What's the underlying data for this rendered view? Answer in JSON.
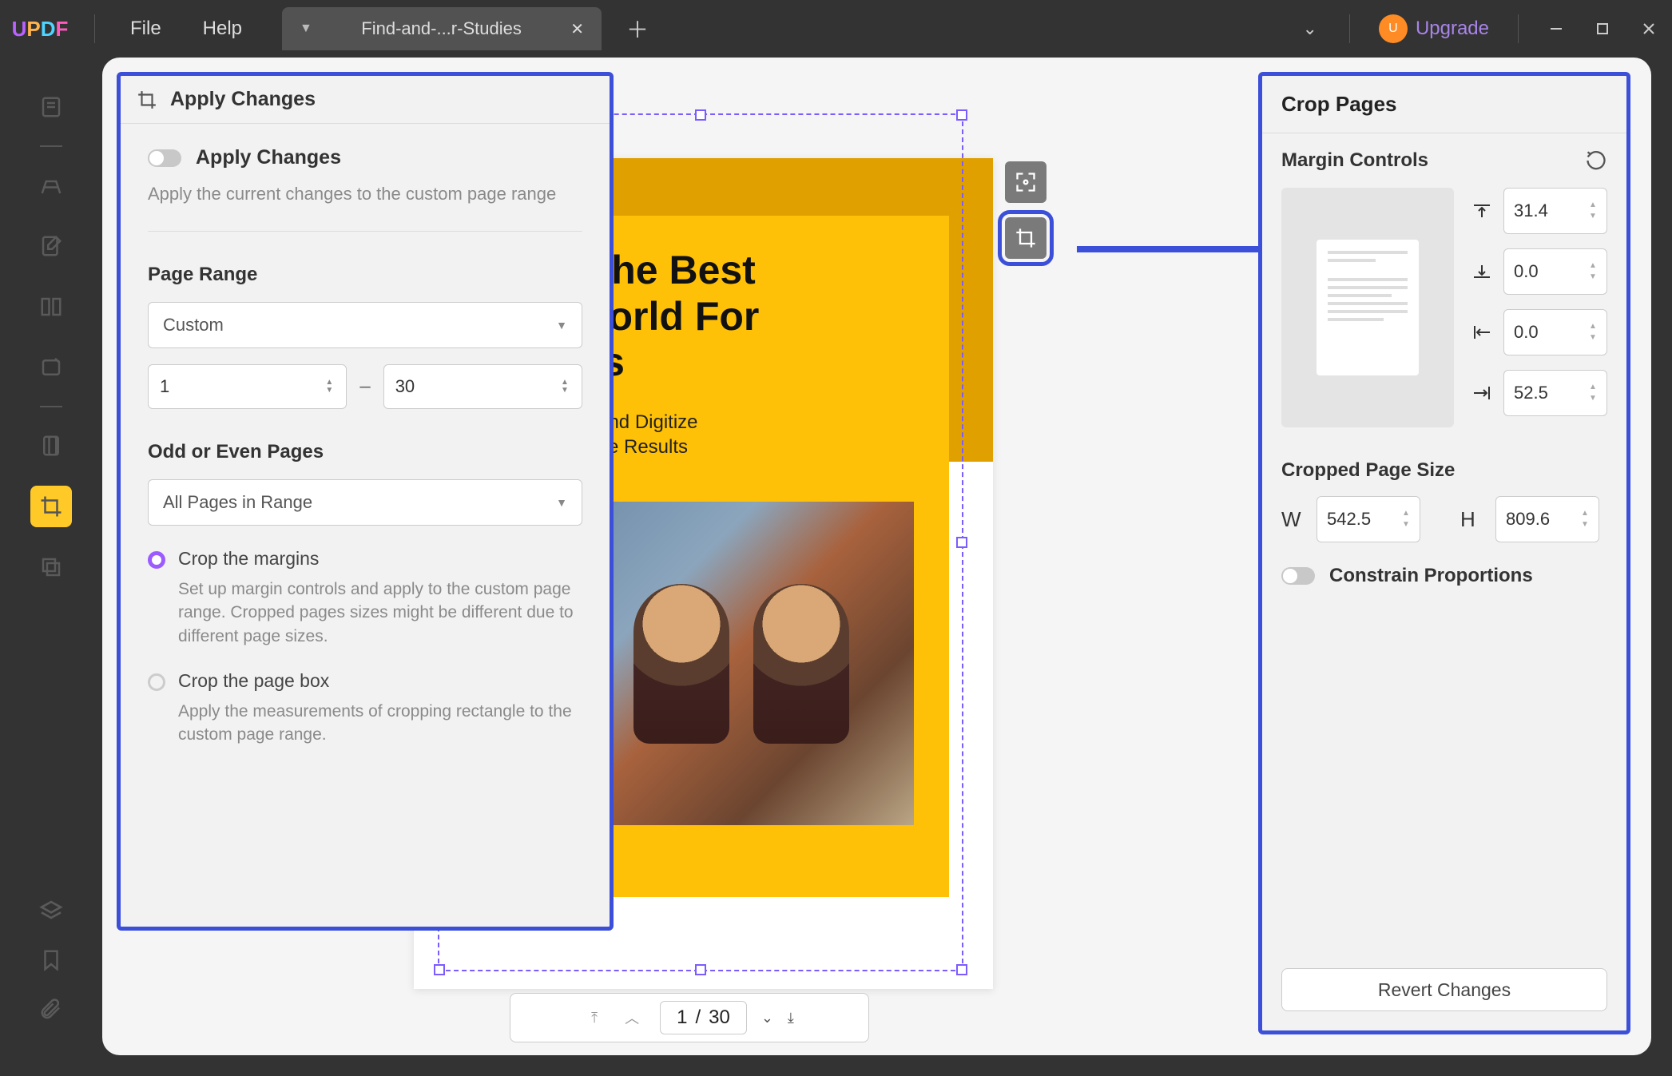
{
  "brand": "UPDF",
  "menu": {
    "file": "File",
    "help": "Help"
  },
  "tab": {
    "name": "Find-and-...r-Studies"
  },
  "upgrade": {
    "badge": "U",
    "label": "Upgrade"
  },
  "apply_panel": {
    "title": "Apply Changes",
    "toggle_label": "Apply Changes",
    "toggle_help": "Apply the current changes to the custom page range",
    "page_range_title": "Page Range",
    "range_mode": "Custom",
    "range_from": "1",
    "range_to": "30",
    "odd_even_title": "Odd or Even Pages",
    "odd_even_value": "All Pages in Range",
    "radio1_label": "Crop the margins",
    "radio1_help": "Set up margin controls and apply to the custom page range. Cropped pages sizes might be different due to different page sizes.",
    "radio2_label": "Crop the page box",
    "radio2_help": "Apply the measurements of cropping rectangle to the custom page range."
  },
  "document": {
    "heading_line1": "           ply For the Best",
    "heading_line2": "          n The World For",
    "heading_line3": "      r Studies",
    "sub_line1": "           cational Institute and Digitize",
    "sub_line2": "          Quick and Effective Results"
  },
  "crop_button": "Crop",
  "right_panel": {
    "title": "Crop Pages",
    "margin_title": "Margin Controls",
    "top": "31.4",
    "bottom": "0.0",
    "left": "0.0",
    "right": "52.5",
    "size_title": "Cropped Page Size",
    "w_label": "W",
    "h_label": "H",
    "w": "542.5",
    "h": "809.6",
    "constrain": "Constrain Proportions",
    "revert": "Revert Changes"
  },
  "pager": {
    "current": "1",
    "sep": "/",
    "total": "30"
  }
}
